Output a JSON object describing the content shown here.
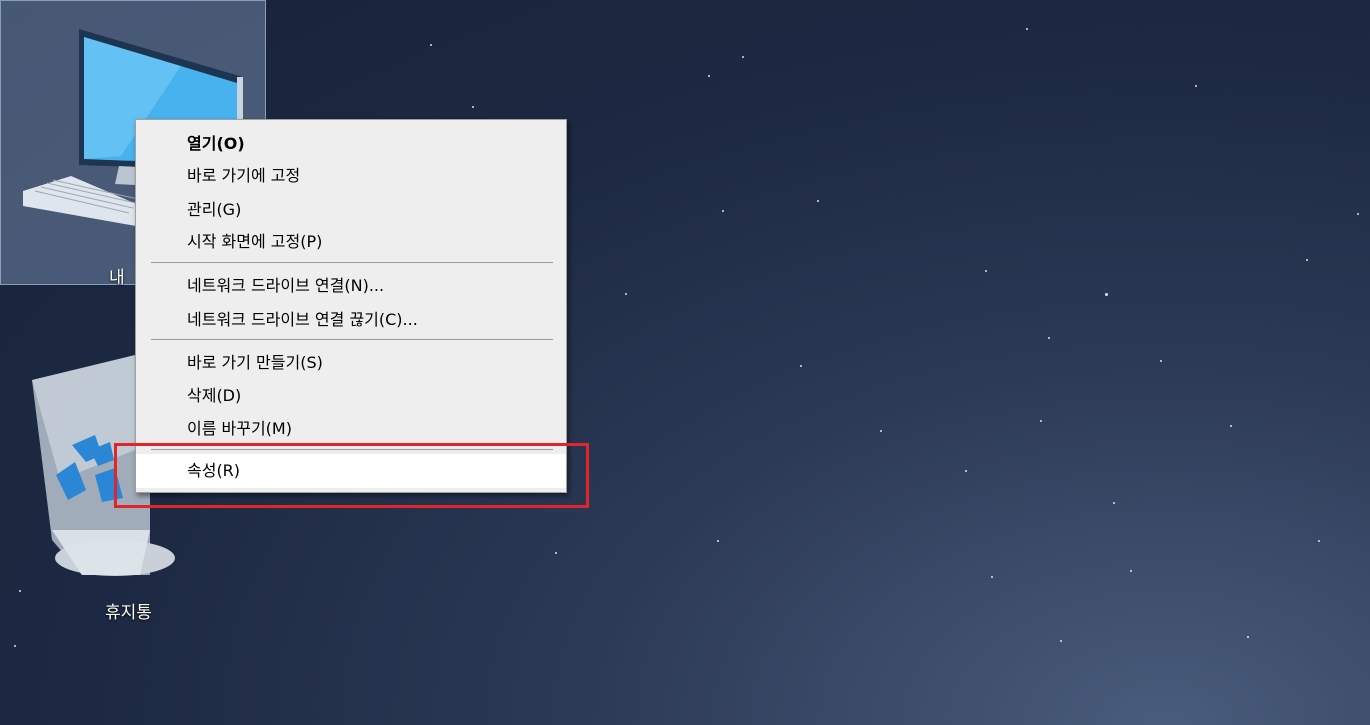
{
  "desktop": {
    "icons": [
      {
        "label": "내"
      },
      {
        "label": "휴지통"
      }
    ]
  },
  "context_menu": {
    "items": [
      {
        "label": "열기(O)"
      },
      {
        "label": "바로 가기에 고정"
      },
      {
        "label": "관리(G)"
      },
      {
        "label": "시작 화면에 고정(P)"
      },
      {
        "label": "네트워크 드라이브 연결(N)..."
      },
      {
        "label": "네트워크 드라이브 연결 끊기(C)..."
      },
      {
        "label": "바로 가기 만들기(S)"
      },
      {
        "label": "삭제(D)"
      },
      {
        "label": "이름 바꾸기(M)"
      },
      {
        "label": "속성(R)"
      }
    ],
    "highlighted_item": "속성(R)"
  },
  "colors": {
    "highlight_box": "#e0262b",
    "menu_background": "#eeeeee"
  }
}
